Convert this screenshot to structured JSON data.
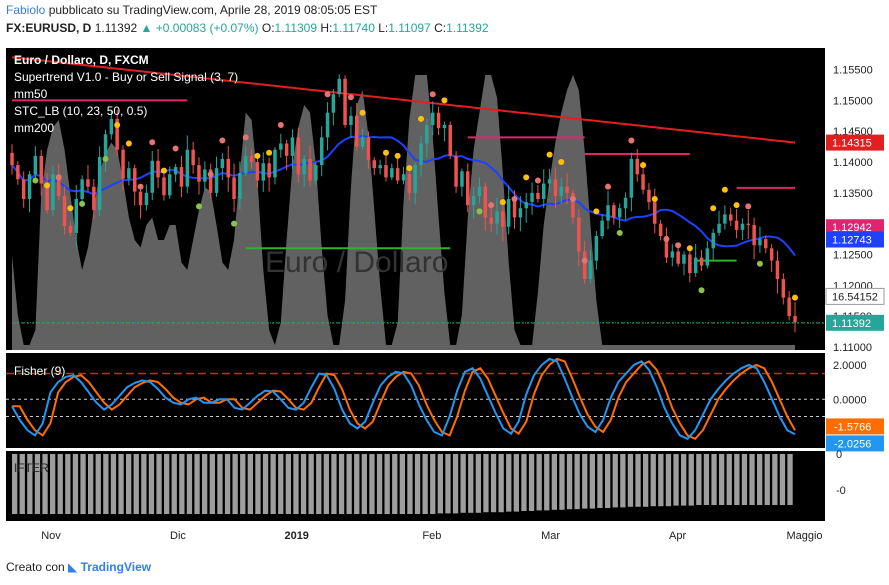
{
  "header": {
    "user": "Fabiolo",
    "published": "pubblicato su TradingView.com, Aprile 28, 2019 08:05:05 EST",
    "symbol": "FX:EURUSD, D",
    "last": "1.11392",
    "change": "+0.00083 (+0.07%)",
    "o_label": "O:",
    "o": "1.11309",
    "h_label": "H:",
    "h": "1.11740",
    "l_label": "L:",
    "l": "1.11097",
    "c_label": "C:",
    "c": "1.11392"
  },
  "legend": {
    "title": "Euro / Dollaro, D, FXCM",
    "ind1": "Supertrend V1.0 - Buy or Sell Signal (3, 7)",
    "ind2": "mm50",
    "ind3": "STC_LB (10, 23, 50, 0.5)",
    "ind4": "mm200"
  },
  "watermark": "Euro / Dollaro",
  "fisher": {
    "label": "Fisher (9)"
  },
  "ifter": {
    "label": "IFTER"
  },
  "footer": {
    "created": "Creato con",
    "brand": "TradingView"
  },
  "colors": {
    "bull": "#26a69a",
    "bear": "#ef5350",
    "mm200": "#e02020",
    "mm50": "#1e40ff",
    "supertrend_up": "#2bb52b",
    "supertrend_dn": "#e0246e",
    "stc": "#b0b0b0",
    "fisher": "#2196f3",
    "trigger": "#ff6d00",
    "background": "#000000"
  },
  "chart_data": [
    {
      "type": "candlestick",
      "title": "Euro / Dollaro, D, FXCM",
      "x_ticks": [
        "Nov",
        "Dic",
        "2019",
        "Feb",
        "Mar",
        "Apr",
        "Maggio"
      ],
      "y_ticks": [
        "1.15500",
        "1.15000",
        "1.14500",
        "1.14000",
        "1.13500",
        "1.13000",
        "1.12500",
        "1.12000",
        "1.11500",
        "1.11000"
      ],
      "ylim": [
        1.1095,
        1.1585
      ],
      "price_labels": [
        {
          "name": "mm200",
          "value": 1.14315,
          "text": "1.14315",
          "color": "#e02020"
        },
        {
          "name": "Supertrend",
          "value": 1.12942,
          "text": "1.12942",
          "color": "#e0246e"
        },
        {
          "name": "mm50",
          "value": 1.12743,
          "text": "1.12743",
          "color": "#1e40ff"
        },
        {
          "name": "STC_LB",
          "value": 1.1182,
          "text": "16.54152",
          "color": "#ffffff"
        },
        {
          "name": "Price",
          "value": 1.11392,
          "text": "1.11392",
          "color": "#26a69a"
        }
      ],
      "closes": [
        1.1395,
        1.1372,
        1.134,
        1.138,
        1.141,
        1.1365,
        1.1322,
        1.138,
        1.1345,
        1.1296,
        1.1285,
        1.134,
        1.1372,
        1.136,
        1.1322,
        1.1408,
        1.1445,
        1.147,
        1.142,
        1.1373,
        1.139,
        1.1352,
        1.133,
        1.135,
        1.1402,
        1.1375,
        1.1346,
        1.138,
        1.1392,
        1.136,
        1.142,
        1.1395,
        1.1368,
        1.1388,
        1.135,
        1.139,
        1.1405,
        1.1375,
        1.134,
        1.1382,
        1.141,
        1.14,
        1.137,
        1.1398,
        1.1375,
        1.142,
        1.143,
        1.141,
        1.144,
        1.138,
        1.1405,
        1.137,
        1.1395,
        1.144,
        1.148,
        1.151,
        1.1535,
        1.146,
        1.1475,
        1.1425,
        1.144,
        1.1403,
        1.139,
        1.1395,
        1.1375,
        1.139,
        1.137,
        1.138,
        1.135,
        1.1395,
        1.143,
        1.146,
        1.148,
        1.1455,
        1.146,
        1.141,
        1.136,
        1.1385,
        1.133,
        1.1345,
        1.136,
        1.131,
        1.13,
        1.132,
        1.1295,
        1.134,
        1.131,
        1.1325,
        1.1335,
        1.135,
        1.134,
        1.1365,
        1.1372,
        1.1345,
        1.136,
        1.135,
        1.131,
        1.1255,
        1.121,
        1.124,
        1.128,
        1.1305,
        1.133,
        1.131,
        1.1325,
        1.1342,
        1.1405,
        1.138,
        1.1355,
        1.1335,
        1.13,
        1.128,
        1.1245,
        1.1255,
        1.1235,
        1.125,
        1.122,
        1.1245,
        1.1232,
        1.126,
        1.1285,
        1.13,
        1.1315,
        1.1305,
        1.129,
        1.13,
        1.1298,
        1.1265,
        1.1275,
        1.126,
        1.124,
        1.121,
        1.118,
        1.115,
        1.114
      ]
    },
    {
      "type": "line",
      "title": "Fisher (9)",
      "y_ticks": [
        "2.0000",
        "0.0000"
      ],
      "ylim": [
        -2.6,
        2.4
      ],
      "levels": [
        1.5,
        0.0,
        -1.0
      ],
      "last_values": [
        {
          "name": "trigger",
          "text": "-1.5766",
          "value": -1.5766,
          "color": "#ff6d00"
        },
        {
          "name": "fisher",
          "text": "-2.0256",
          "value": -2.0256,
          "color": "#2196f3"
        }
      ],
      "fisher": [
        -0.4,
        -1.2,
        -1.8,
        -2.1,
        -1.4,
        0.4,
        1.0,
        1.3,
        1.4,
        1.0,
        0.4,
        -0.2,
        -0.6,
        -0.3,
        0.2,
        0.7,
        0.95,
        1.1,
        1.0,
        0.6,
        0.1,
        -0.2,
        -0.3,
        0.0,
        0.1,
        -0.2,
        -0.2,
        0.0,
        0.0,
        -0.5,
        -0.6,
        -0.2,
        0.2,
        0.5,
        0.45,
        0.0,
        -0.5,
        -0.6,
        -0.2,
        0.7,
        1.5,
        1.4,
        0.6,
        -0.6,
        -1.4,
        -1.7,
        -1.3,
        -0.2,
        0.8,
        1.3,
        1.6,
        1.5,
        0.8,
        -0.3,
        -1.2,
        -1.9,
        -2.1,
        -1.0,
        0.5,
        1.6,
        1.8,
        1.2,
        0.2,
        -0.8,
        -1.7,
        -2.0,
        -1.3,
        0.3,
        1.4,
        2.0,
        2.35,
        2.2,
        1.2,
        0.1,
        -0.9,
        -1.6,
        -1.9,
        -1.2,
        0.1,
        1.0,
        1.5,
        2.0,
        2.2,
        1.7,
        0.7,
        -0.5,
        -1.4,
        -2.1,
        -2.3,
        -1.8,
        -0.9,
        0.0,
        0.6,
        1.1,
        1.5,
        1.8,
        2.0,
        1.8,
        1.0,
        0.0,
        -1.0,
        -1.8,
        -2.03
      ]
    },
    {
      "type": "bar",
      "title": "IFTER",
      "y_ticks": [
        "0",
        "-0"
      ],
      "values": [
        -1.0,
        -1.0,
        -1.0,
        -1.0,
        -1.0,
        -1.0,
        -1.0,
        -1.0,
        -1.0,
        -1.0,
        -1.0,
        -1.0,
        -1.0,
        -1.0,
        -1.0,
        -1.0,
        -1.0,
        -1.0,
        -1.0,
        -1.0,
        -1.0,
        -1.0,
        -1.0,
        -1.0,
        -1.0,
        -1.0,
        -1.0,
        -1.0,
        -1.0,
        -1.0,
        -1.0,
        -1.0,
        -1.0,
        -1.0,
        -1.0,
        -1.0,
        -1.0,
        -1.0,
        -1.0,
        -1.0,
        -1.0,
        -1.0,
        -1.0,
        -1.0,
        -1.0,
        -1.0,
        -1.0,
        -1.0,
        -1.0,
        -1.0,
        -1.0,
        -1.0,
        -1.0,
        -1.0,
        -1.0,
        -1.0,
        -0.99,
        -0.99,
        -0.99,
        -0.98,
        -0.98,
        -0.98,
        -0.97,
        -0.97,
        -0.97,
        -0.96,
        -0.96,
        -0.95,
        -0.95,
        -0.94,
        -0.94,
        -0.93,
        -0.93,
        -0.92,
        -0.92,
        -0.91,
        -0.91,
        -0.9,
        -0.9,
        -0.89,
        -0.89,
        -0.88,
        -0.88,
        -0.88,
        -0.87,
        -0.87,
        -0.87,
        -0.86,
        -0.86,
        -0.86,
        -0.85,
        -0.85,
        -0.85,
        -0.85,
        -0.85,
        -0.85,
        -0.85,
        -0.85,
        -0.85,
        -0.85,
        -0.85,
        -0.85,
        -0.85
      ]
    }
  ]
}
